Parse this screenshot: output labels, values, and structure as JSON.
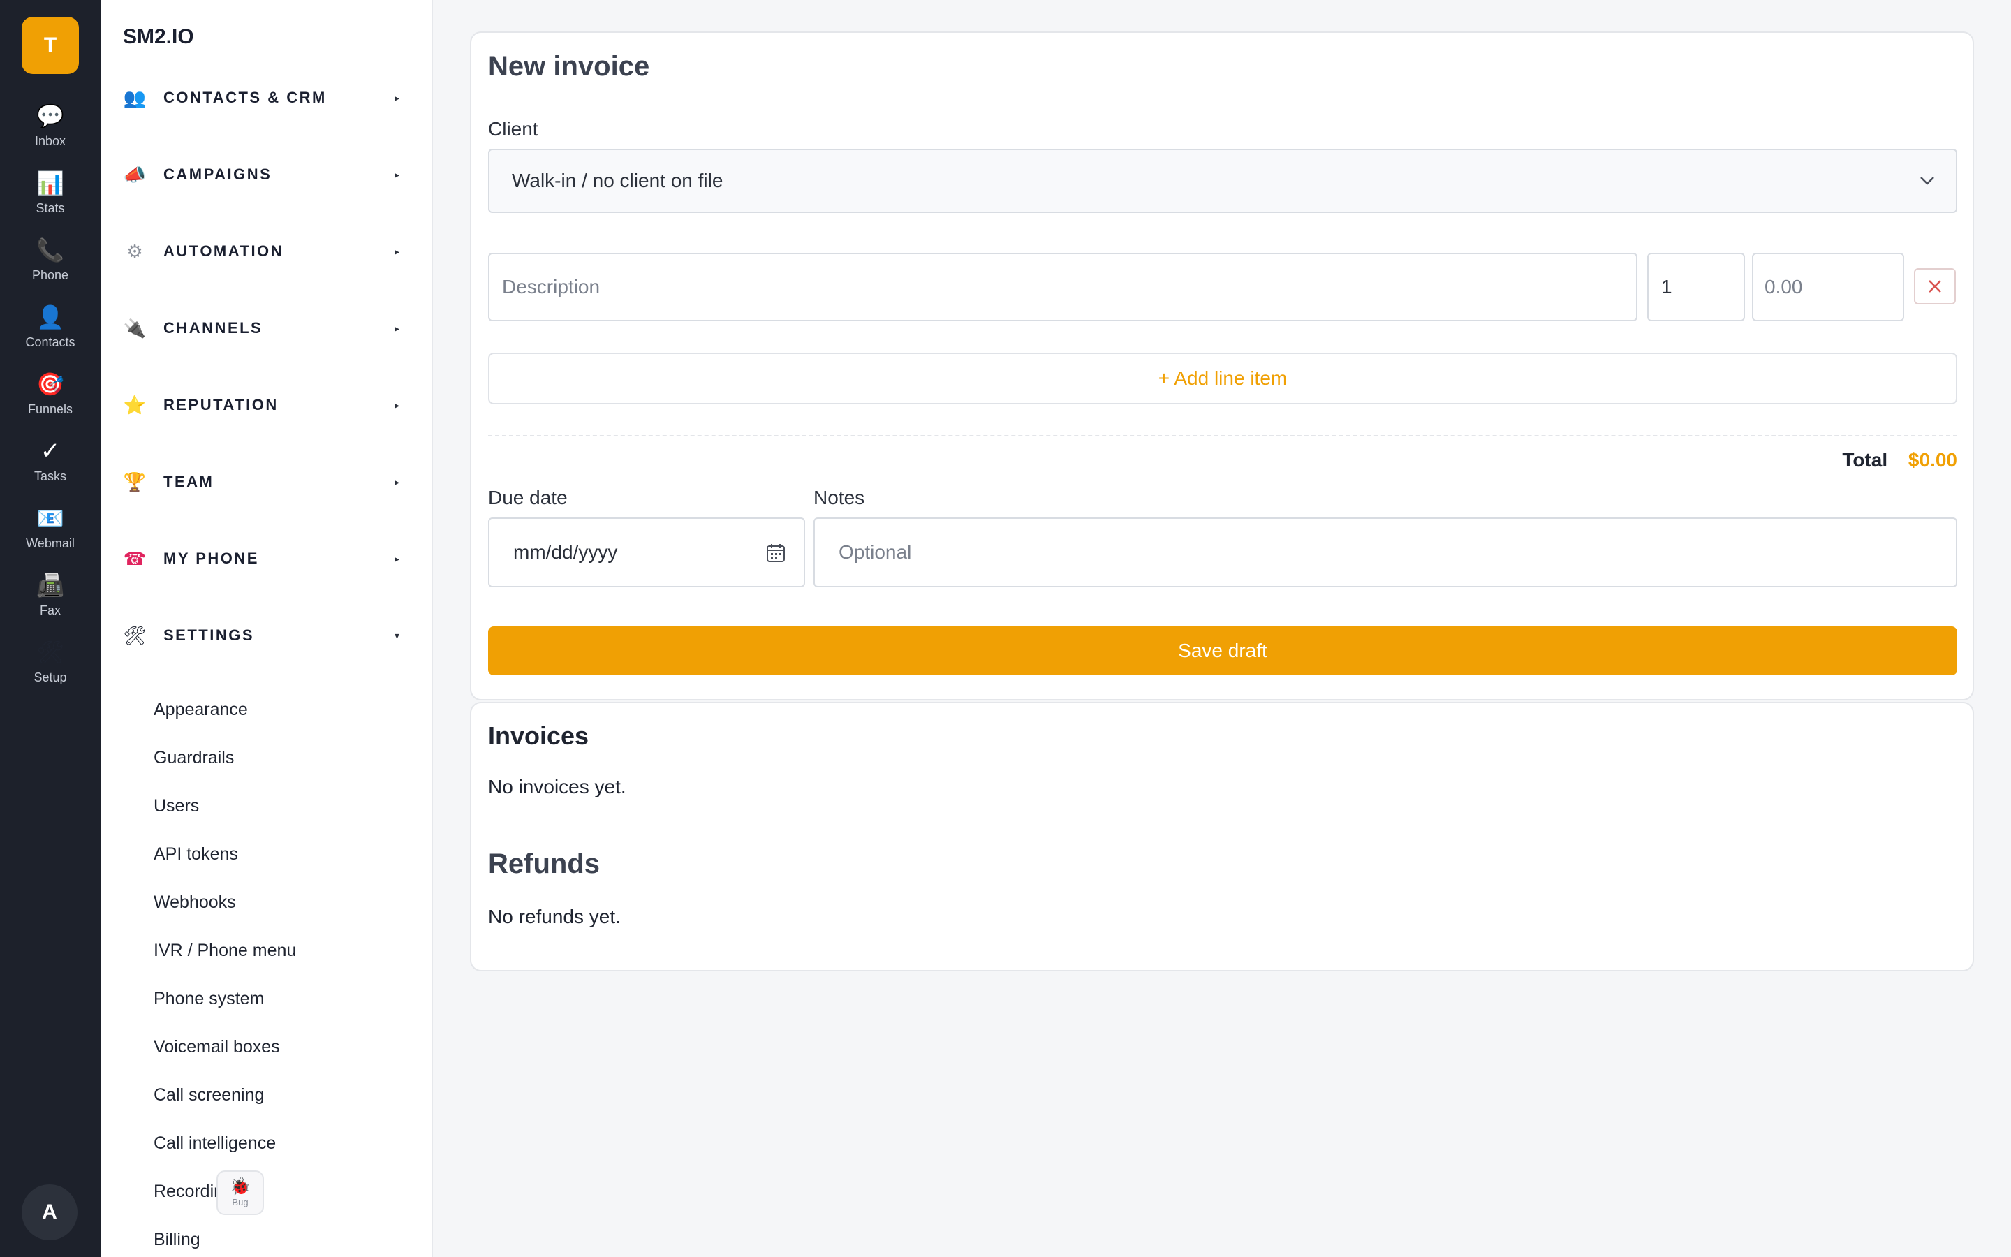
{
  "brand": {
    "initial": "T"
  },
  "rail": {
    "items": [
      {
        "label": "Inbox",
        "icon": "💬"
      },
      {
        "label": "Stats",
        "icon": "📊"
      },
      {
        "label": "Phone",
        "icon": "📞"
      },
      {
        "label": "Contacts",
        "icon": "👤"
      },
      {
        "label": "Funnels",
        "icon": "🎯"
      },
      {
        "label": "Tasks",
        "icon": "✓"
      },
      {
        "label": "Webmail",
        "icon": "📧"
      },
      {
        "label": "Fax",
        "icon": "📠"
      },
      {
        "label": "Setup",
        "icon": "🛠"
      }
    ],
    "avatar": "A"
  },
  "sidebar": {
    "org": "SM2.IO",
    "groups": [
      {
        "label": "CONTACTS & CRM",
        "icon": "👥",
        "caret": "▸"
      },
      {
        "label": "CAMPAIGNS",
        "icon": "📣",
        "caret": "▸"
      },
      {
        "label": "AUTOMATION",
        "icon": "⚙",
        "caret": "▸"
      },
      {
        "label": "CHANNELS",
        "icon": "🔌",
        "caret": "▸"
      },
      {
        "label": "REPUTATION",
        "icon": "⭐",
        "caret": "▸"
      },
      {
        "label": "TEAM",
        "icon": "🏆",
        "caret": "▸"
      },
      {
        "label": "MY PHONE",
        "icon": "☎",
        "caret": "▸"
      },
      {
        "label": "SETTINGS",
        "icon": "🛠",
        "caret": "▾"
      }
    ],
    "settings_items": [
      "Appearance",
      "Guardrails",
      "Users",
      "API tokens",
      "Webhooks",
      "IVR / Phone menu",
      "Phone system",
      "Voicemail boxes",
      "Call screening",
      "Call intelligence",
      "Recordings",
      "Billing"
    ],
    "bug": {
      "label": "Bug",
      "icon": "🐞"
    }
  },
  "invoice": {
    "title": "New invoice",
    "client_label": "Client",
    "client_value": "Walk-in / no client on file",
    "line": {
      "description_placeholder": "Description",
      "qty_value": "1",
      "price_placeholder": "0.00"
    },
    "add_line_label": "+ Add line item",
    "total_label": "Total",
    "total_value": "$0.00",
    "due_label": "Due date",
    "due_placeholder": "mm/dd/yyyy",
    "notes_label": "Notes",
    "notes_placeholder": "Optional",
    "save_label": "Save draft"
  },
  "lists": {
    "invoices_title": "Invoices",
    "invoices_empty": "No invoices yet.",
    "refunds_title": "Refunds",
    "refunds_empty": "No refunds yet."
  },
  "colors": {
    "accent": "#f0a004",
    "rail_bg": "#1d212b",
    "page_bg": "#f5f6f8",
    "danger": "#d9534f"
  }
}
